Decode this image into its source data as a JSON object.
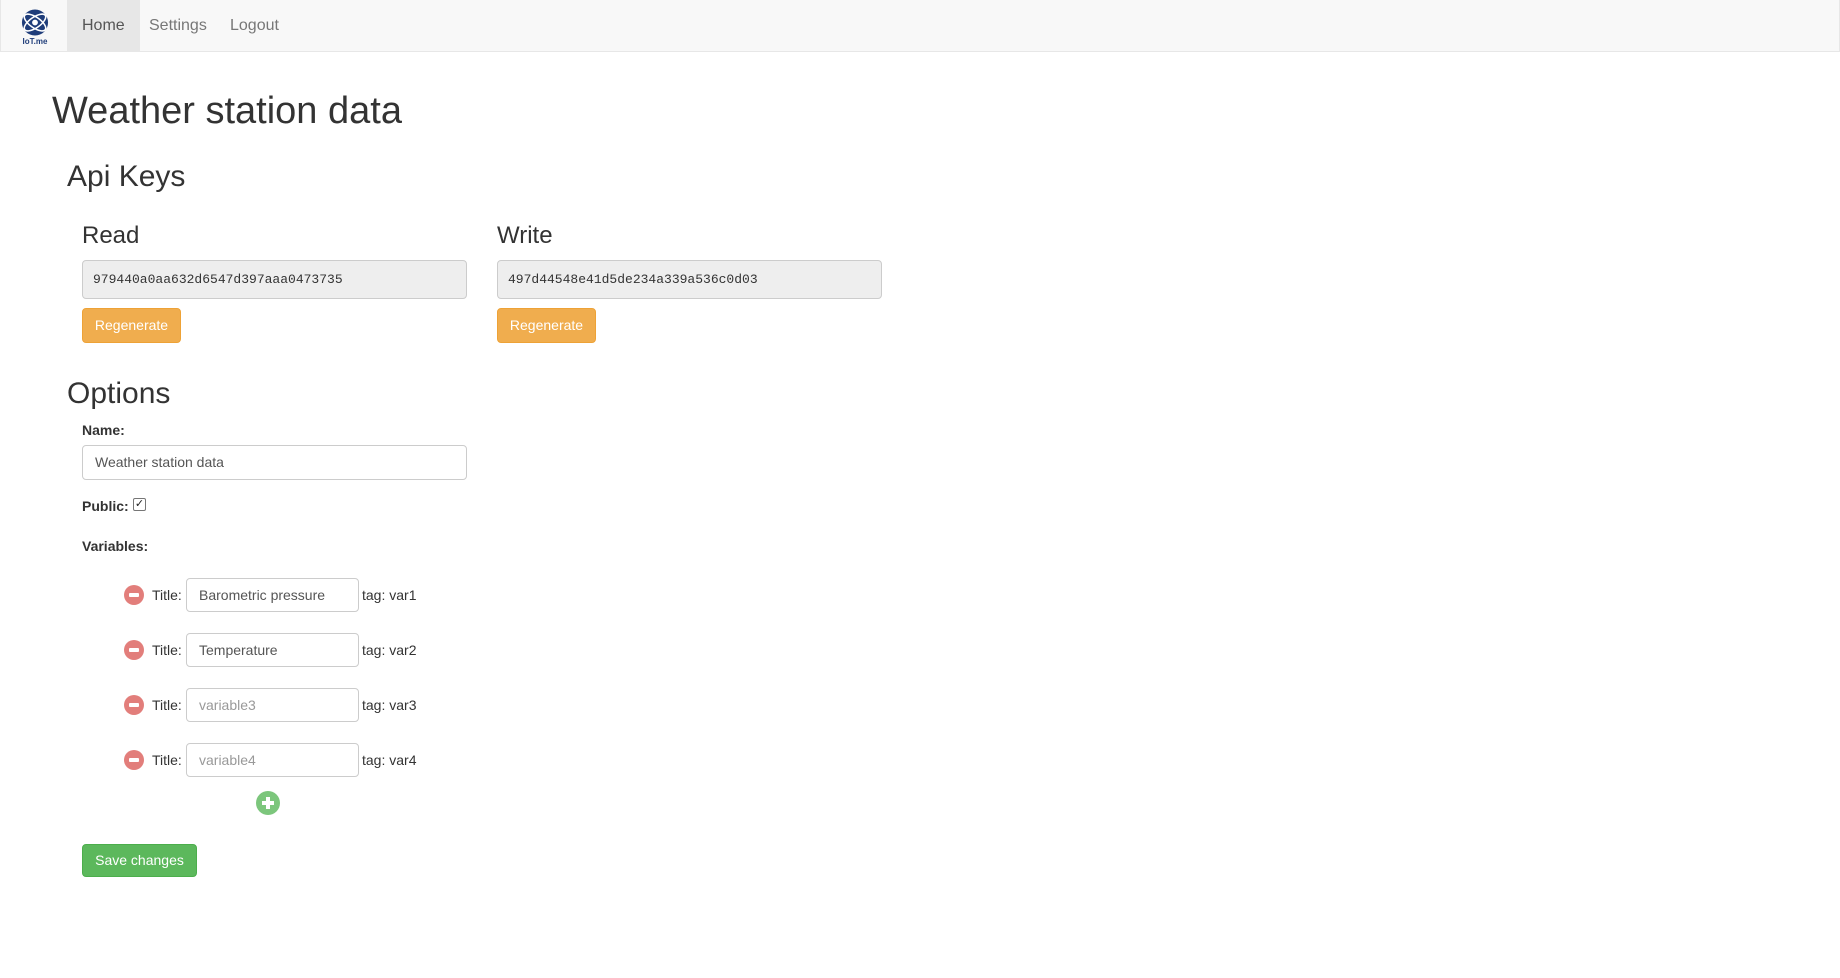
{
  "navbar": {
    "brand_text": "IoT.me",
    "items": [
      {
        "label": "Home",
        "active": true
      },
      {
        "label": "Settings",
        "active": false
      },
      {
        "label": "Logout",
        "active": false
      }
    ]
  },
  "page": {
    "title": "Weather station data"
  },
  "api_keys": {
    "heading": "Api Keys",
    "read": {
      "label": "Read",
      "value": "979440a0aa632d6547d397aaa0473735",
      "button": "Regenerate"
    },
    "write": {
      "label": "Write",
      "value": "497d44548e41d5de234a339a536c0d03",
      "button": "Regenerate"
    }
  },
  "options": {
    "heading": "Options",
    "name_label": "Name:",
    "name_value": "Weather station data",
    "public_label": "Public:",
    "public_checked": true,
    "variables_label": "Variables:",
    "variables": [
      {
        "title_label": "Title:",
        "value": "Barometric pressure",
        "placeholder": "",
        "tag": "tag: var1"
      },
      {
        "title_label": "Title:",
        "value": "Temperature",
        "placeholder": "",
        "tag": "tag: var2"
      },
      {
        "title_label": "Title:",
        "value": "",
        "placeholder": "variable3",
        "tag": "tag: var3"
      },
      {
        "title_label": "Title:",
        "value": "",
        "placeholder": "variable4",
        "tag": "tag: var4"
      }
    ],
    "save_button": "Save changes"
  },
  "colors": {
    "warning": "#f0ad4e",
    "success": "#5cb85c",
    "danger": "#d9534f",
    "brand": "#1f3d7a"
  },
  "icons": {
    "remove": "minus-circle-icon",
    "add": "plus-circle-icon",
    "logo": "globe-icon"
  }
}
